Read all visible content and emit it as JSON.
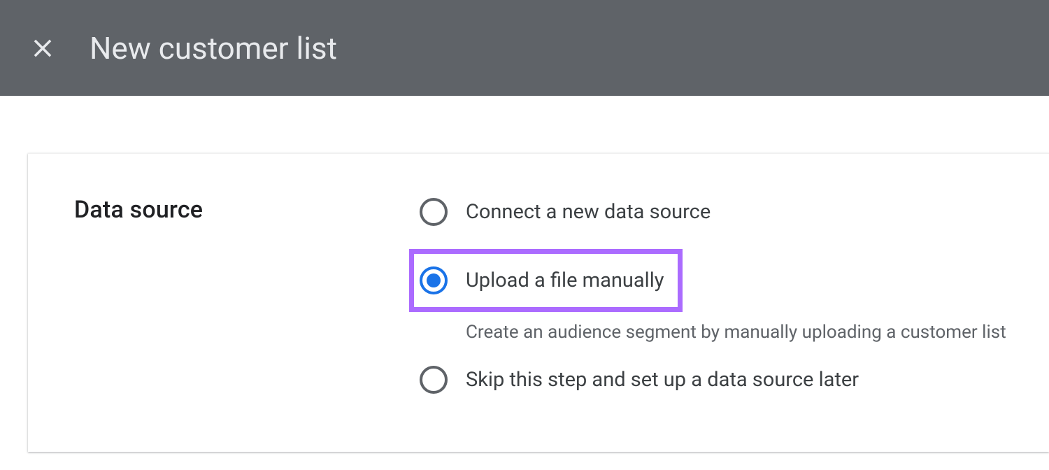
{
  "header": {
    "title": "New customer list"
  },
  "section": {
    "label": "Data source",
    "options": [
      {
        "label": "Connect a new data source"
      },
      {
        "label": "Upload a file manually",
        "description": "Create an audience segment by manually uploading a customer list"
      },
      {
        "label": "Skip this step and set up a data source later"
      }
    ]
  }
}
